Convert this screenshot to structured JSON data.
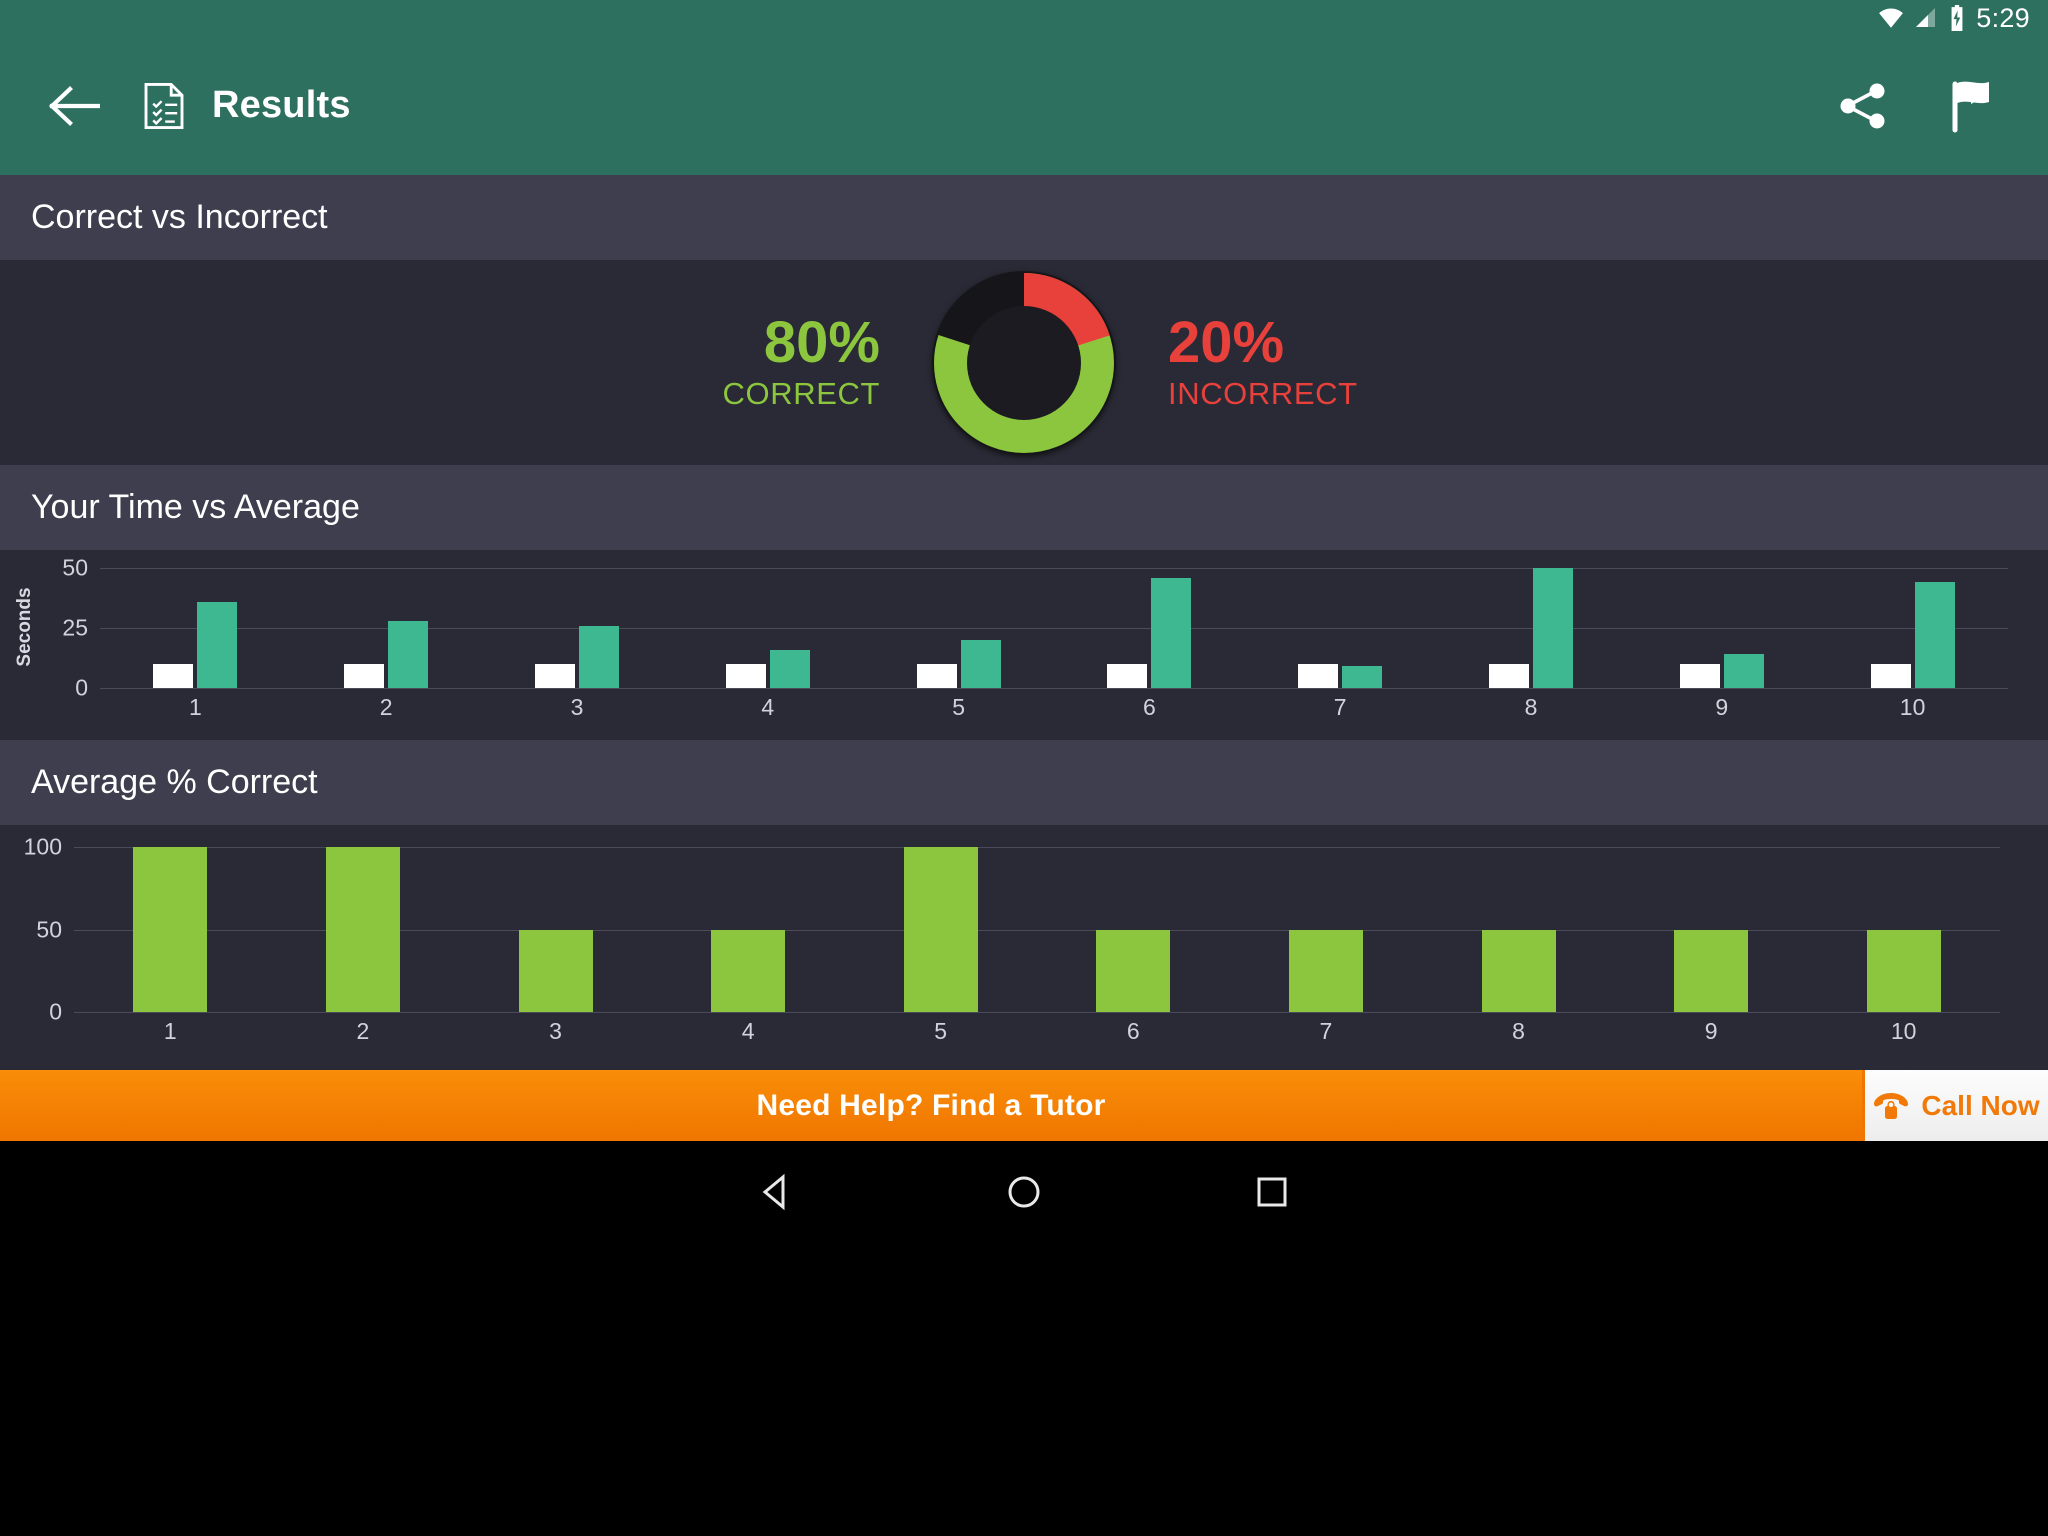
{
  "status_bar": {
    "time": "5:29",
    "icons": [
      "wifi-icon",
      "cell-signal-icon",
      "battery-charging-icon"
    ]
  },
  "app_bar": {
    "back_icon": "back-arrow-icon",
    "doc_icon": "results-document-icon",
    "title": "Results",
    "share_icon": "share-icon",
    "next_icon": "flag-next-icon"
  },
  "sections": {
    "correct_vs_incorrect": {
      "title": "Correct vs Incorrect",
      "correct_pct": "80%",
      "correct_label": "CORRECT",
      "incorrect_pct": "20%",
      "incorrect_label": "INCORRECT",
      "correct_color": "#8CC63E",
      "incorrect_color": "#E8403A",
      "donut_hole_color": "#1B1B21"
    },
    "time_vs_average": {
      "title": "Your Time vs Average"
    },
    "average_correct": {
      "title": "Average % Correct"
    }
  },
  "chart_data": [
    {
      "type": "bar",
      "title": "Your Time vs Average",
      "xlabel": "",
      "ylabel": "Seconds",
      "categories": [
        "1",
        "2",
        "3",
        "4",
        "5",
        "6",
        "7",
        "8",
        "9",
        "10"
      ],
      "yticks": [
        0,
        25,
        50
      ],
      "ylim": [
        0,
        50
      ],
      "grid": true,
      "legend": "none",
      "series": [
        {
          "name": "Your Time",
          "color": "#FFFFFF",
          "values": [
            10,
            10,
            10,
            10,
            10,
            10,
            10,
            10,
            10,
            10
          ]
        },
        {
          "name": "Average",
          "color": "#3DB890",
          "values": [
            36,
            28,
            26,
            16,
            20,
            46,
            9,
            50,
            14,
            44
          ]
        }
      ]
    },
    {
      "type": "bar",
      "title": "Average % Correct",
      "xlabel": "",
      "ylabel": "",
      "categories": [
        "1",
        "2",
        "3",
        "4",
        "5",
        "6",
        "7",
        "8",
        "9",
        "10"
      ],
      "yticks": [
        0,
        50,
        100
      ],
      "ylim": [
        0,
        100
      ],
      "grid": true,
      "legend": "none",
      "series": [
        {
          "name": "Average % Correct",
          "color": "#8CC63E",
          "values": [
            100,
            100,
            50,
            50,
            100,
            50,
            50,
            50,
            50,
            50
          ]
        }
      ]
    }
  ],
  "ad_banner": {
    "text": "Need Help? Find a Tutor",
    "call_label": "Call Now",
    "phone_icon": "telephone-icon",
    "bg_color": "#F07600"
  },
  "nav_bar": {
    "back_icon": "nav-back-triangle-icon",
    "home_icon": "nav-home-circle-icon",
    "recents_icon": "nav-recents-square-icon"
  }
}
